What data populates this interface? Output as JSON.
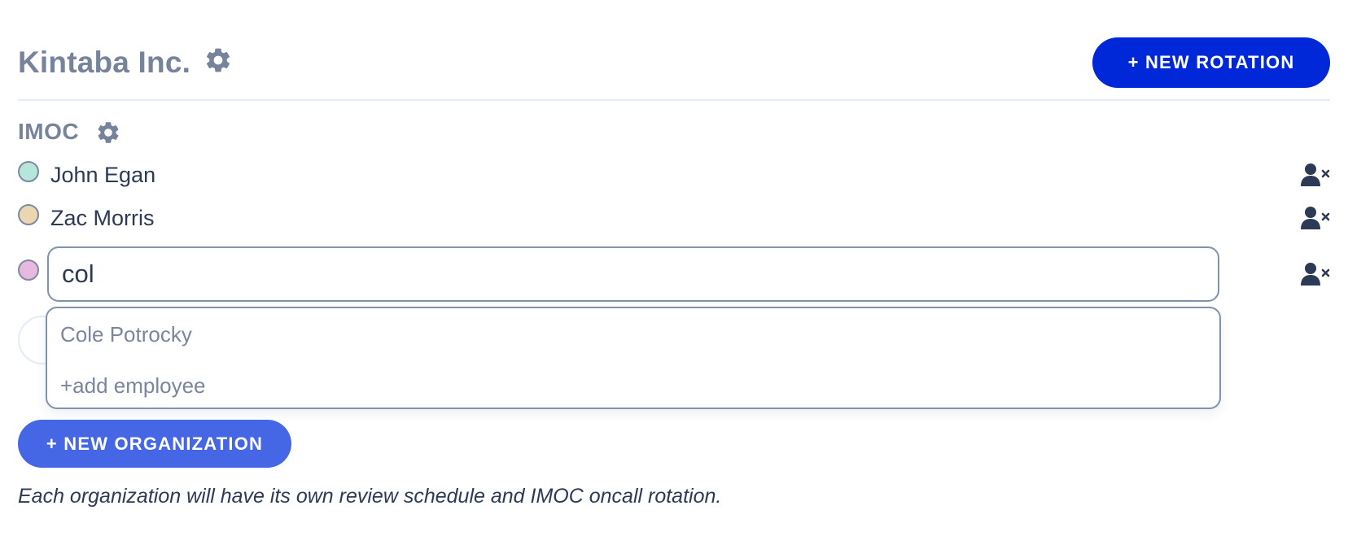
{
  "organization": {
    "name": "Kintaba Inc.",
    "settings_icon": "gear-icon",
    "new_rotation_label": "+ NEW ROTATION"
  },
  "rotation": {
    "name": "IMOC",
    "settings_icon": "gear-icon",
    "members": [
      {
        "name": "John Egan",
        "color": "#b5e6d9"
      },
      {
        "name": "Zac Morris",
        "color": "#ebd6b2"
      }
    ],
    "new_member": {
      "color": "#e8b8de",
      "search_value": "col"
    },
    "remove_icon": "user-remove-icon"
  },
  "autocomplete": {
    "options": [
      "Cole Potrocky",
      "+add employee"
    ]
  },
  "new_organization_label": "+ NEW ORGANIZATION",
  "footer_note": "Each organization will have its own review schedule and IMOC oncall rotation.",
  "colors": {
    "primary_button": "#0028d9",
    "secondary_button": "#4566e5",
    "heading": "#76839a",
    "text": "#2d3a55",
    "divider": "#e3ecf7"
  }
}
